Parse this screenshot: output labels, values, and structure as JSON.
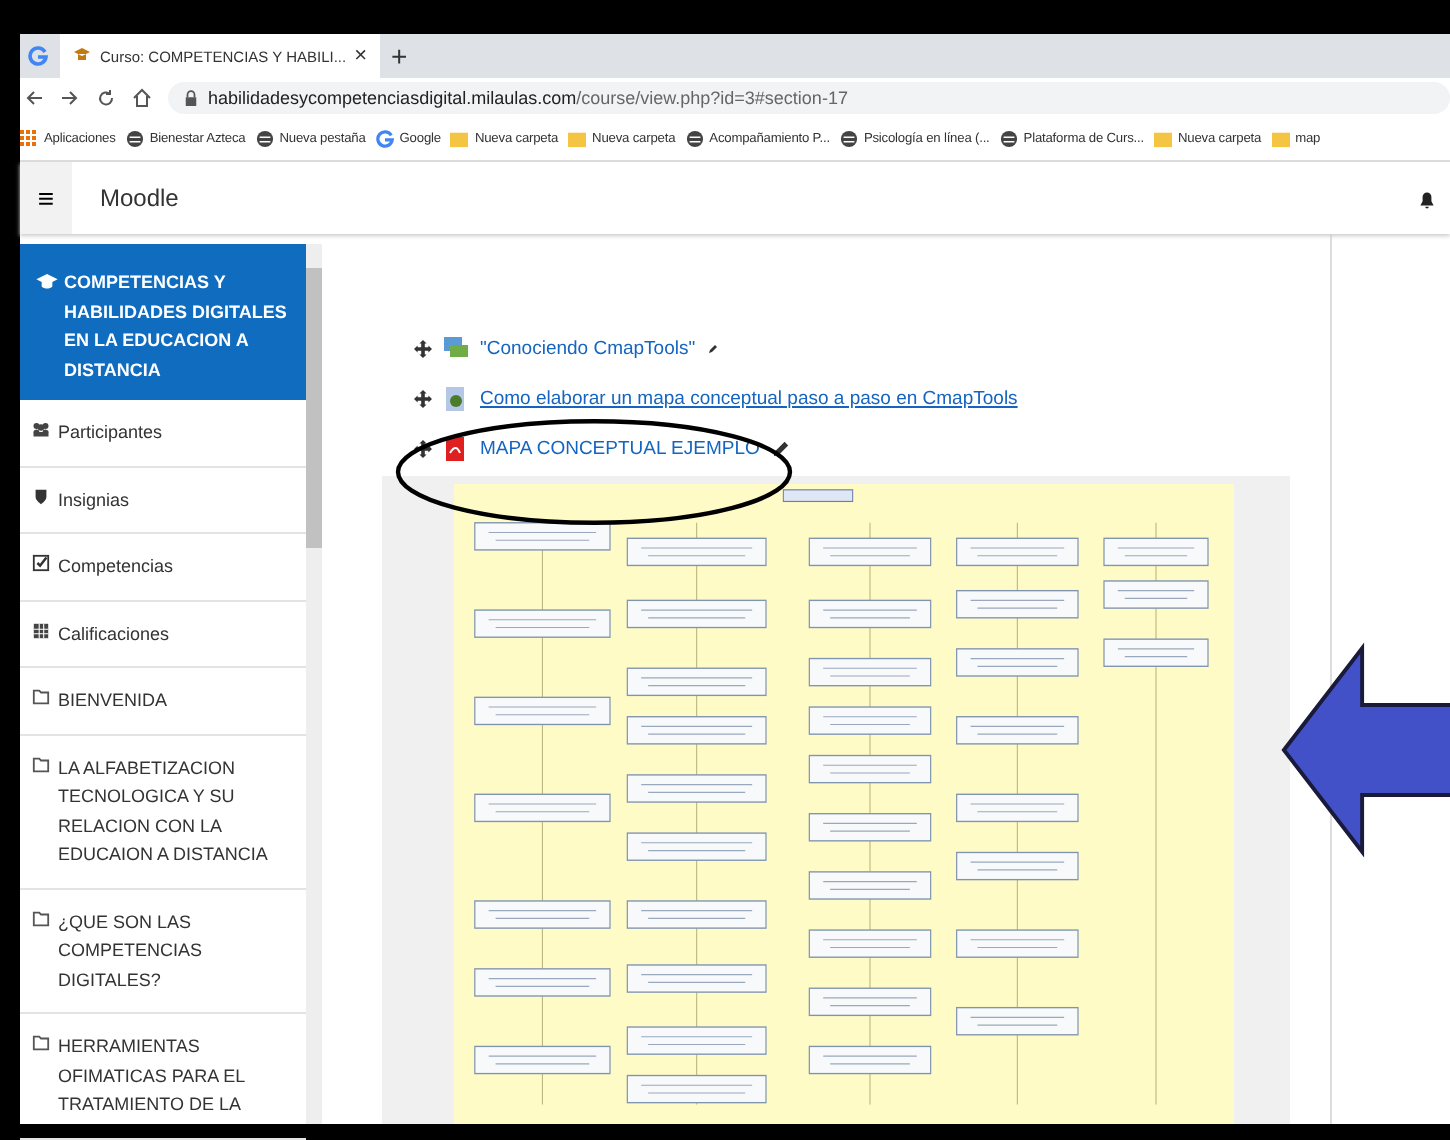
{
  "browser": {
    "tab_title": "Curso: COMPETENCIAS Y HABILI...",
    "close_label": "×",
    "new_tab": "+",
    "url_host": "habilidadesycompetenciasdigital.milaulas.com",
    "url_path": "/course/view.php?id=3#section-17",
    "bookmarks": [
      {
        "kind": "apps",
        "label": "Aplicaciones"
      },
      {
        "kind": "globe",
        "label": "Bienestar Azteca"
      },
      {
        "kind": "globe",
        "label": "Nueva pestaña"
      },
      {
        "kind": "google",
        "label": "Google"
      },
      {
        "kind": "folder",
        "label": "Nueva carpeta"
      },
      {
        "kind": "folder",
        "label": "Nueva carpeta"
      },
      {
        "kind": "globe",
        "label": "Acompañamiento P..."
      },
      {
        "kind": "globe",
        "label": "Psicología en línea (..."
      },
      {
        "kind": "globe",
        "label": "Plataforma de Curs..."
      },
      {
        "kind": "folder",
        "label": "Nueva carpeta"
      },
      {
        "kind": "folder",
        "label": "map"
      }
    ]
  },
  "navbar": {
    "menu": "≡",
    "brand": "Moodle"
  },
  "sidebar": {
    "course_title": "COMPETENCIAS Y HABILIDADES DIGITALES EN LA EDUCACION A DISTANCIA",
    "items": [
      {
        "kind": "participants",
        "label": "Participantes"
      },
      {
        "kind": "badges",
        "label": "Insignias"
      },
      {
        "kind": "competencies",
        "label": "Competencias"
      },
      {
        "kind": "grades",
        "label": "Calificaciones"
      },
      {
        "kind": "section",
        "label": "BIENVENIDA"
      },
      {
        "kind": "section",
        "label": "LA ALFABETIZACION TECNOLOGICA Y SU RELACION CON LA EDUCAION A DISTANCIA"
      },
      {
        "kind": "section",
        "label": "¿QUE SON LAS COMPETENCIAS DIGITALES?"
      },
      {
        "kind": "section",
        "label": "HERRAMIENTAS OFIMATICAS PARA EL TRATAMIENTO DE LA"
      }
    ]
  },
  "activities": [
    {
      "kind": "forum",
      "label": "\"Conociendo CmapTools\"",
      "editing": true
    },
    {
      "kind": "url",
      "label": "Como elaborar un mapa conceptual paso a paso en CmapTools",
      "editing": false
    },
    {
      "kind": "pdf",
      "label": "MAPA CONCEPTUAL EJEMPLO",
      "editing": true
    }
  ]
}
